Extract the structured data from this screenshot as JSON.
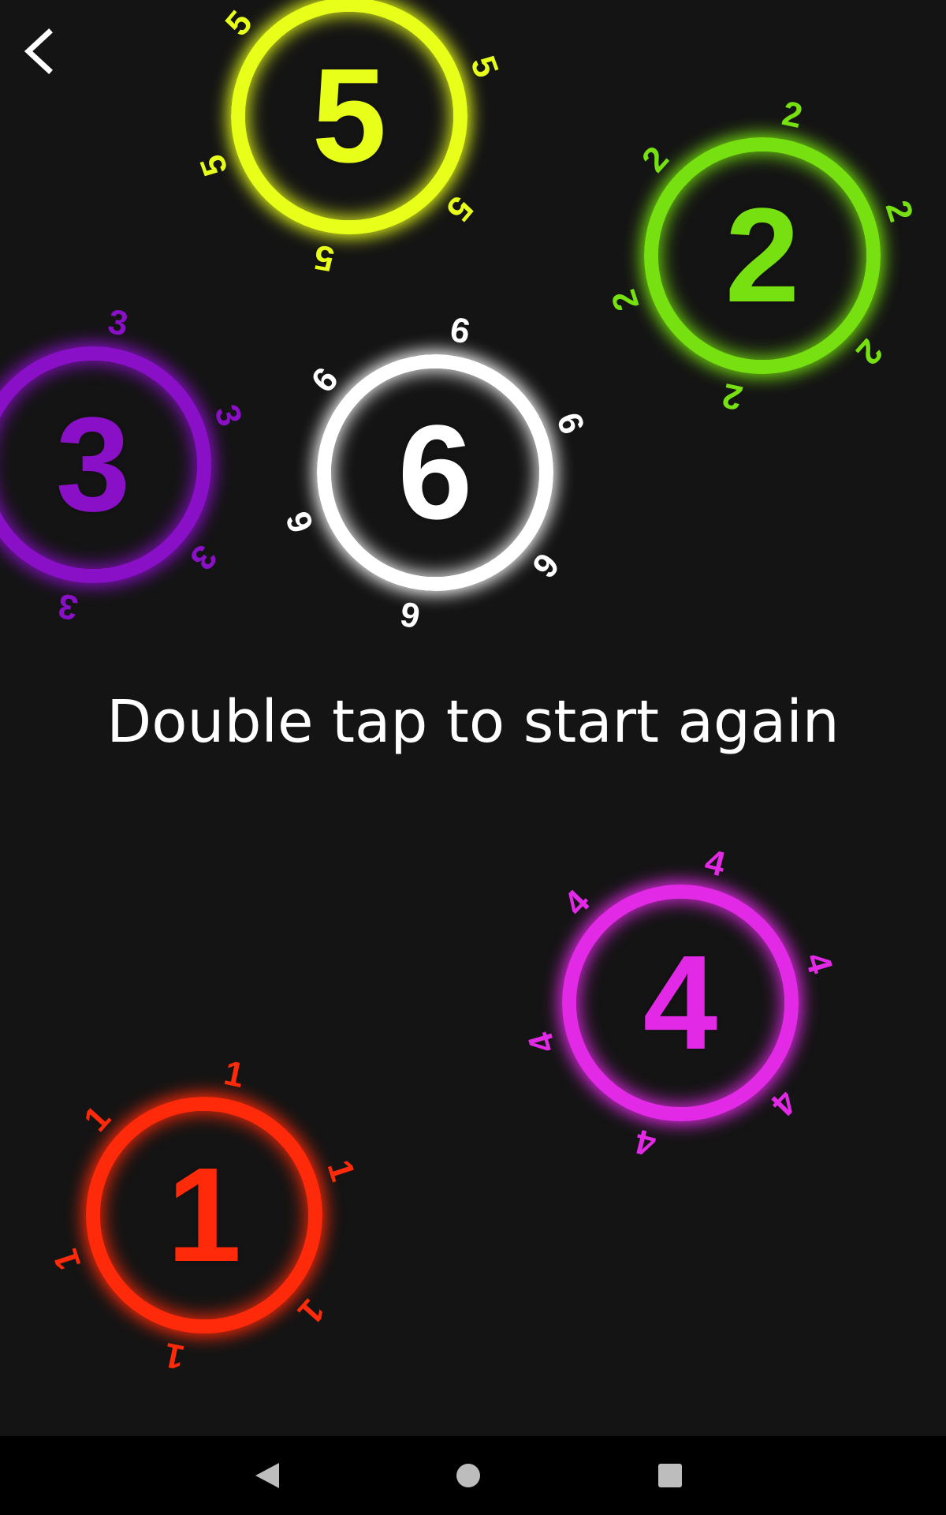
{
  "header": {
    "back_icon": "chevron-left-icon"
  },
  "message": "Double tap to start again",
  "tokens": [
    {
      "id": "5",
      "label": "5",
      "color": "#e8ff1a"
    },
    {
      "id": "2",
      "label": "2",
      "color": "#77e010"
    },
    {
      "id": "3",
      "label": "3",
      "color": "#8a10c8"
    },
    {
      "id": "6",
      "label": "6",
      "color": "#ffffff"
    },
    {
      "id": "4",
      "label": "4",
      "color": "#e22ae6"
    },
    {
      "id": "1",
      "label": "1",
      "color": "#ff2a0a"
    }
  ],
  "nav_bar": {
    "back_icon": "triangle-back-icon",
    "home_icon": "circle-home-icon",
    "recents_icon": "square-recents-icon"
  }
}
